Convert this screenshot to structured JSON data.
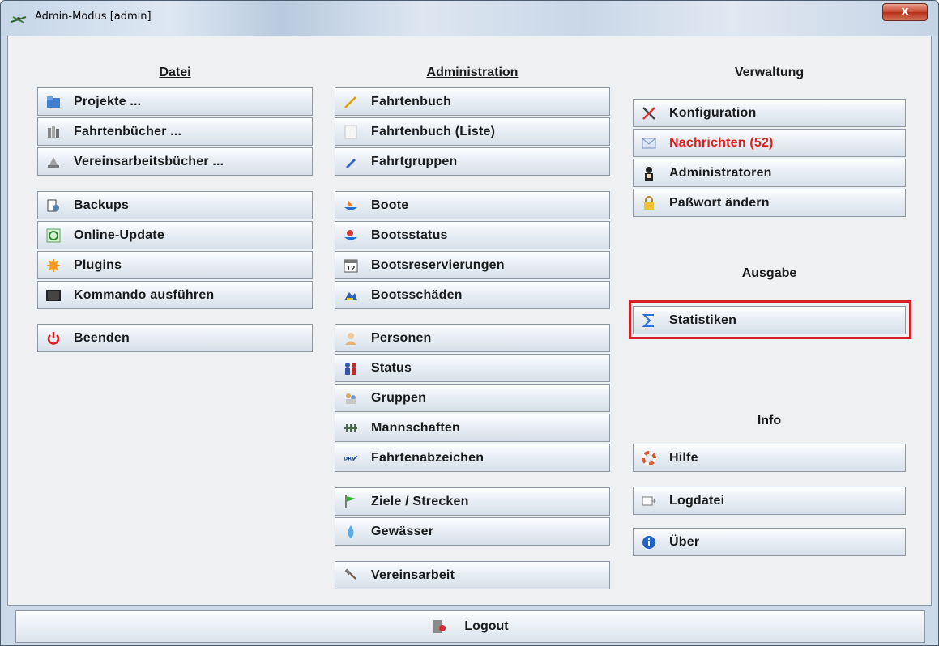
{
  "window": {
    "title": "Admin-Modus [admin]",
    "close_label": "x"
  },
  "datei": {
    "header": "Datei",
    "items": [
      {
        "label": "Projekte ...",
        "icon": "folder-icon"
      },
      {
        "label": "Fahrtenbücher ...",
        "icon": "books-icon"
      },
      {
        "label": "Vereinsarbeitsbücher ...",
        "icon": "work-books-icon"
      },
      {
        "label": "Backups",
        "icon": "backup-icon"
      },
      {
        "label": "Online-Update",
        "icon": "update-icon"
      },
      {
        "label": "Plugins",
        "icon": "plugin-icon"
      },
      {
        "label": "Kommando ausführen",
        "icon": "terminal-icon"
      },
      {
        "label": "Beenden",
        "icon": "power-icon"
      }
    ]
  },
  "administration": {
    "header": "Administration",
    "items": [
      {
        "label": "Fahrtenbuch",
        "icon": "pencil-icon"
      },
      {
        "label": "Fahrtenbuch (Liste)",
        "icon": "list-icon"
      },
      {
        "label": "Fahrtgruppen",
        "icon": "edit-icon"
      },
      {
        "label": "Boote",
        "icon": "boat-icon"
      },
      {
        "label": "Bootsstatus",
        "icon": "boat-status-icon"
      },
      {
        "label": "Bootsreservierungen",
        "icon": "calendar-icon"
      },
      {
        "label": "Bootsschäden",
        "icon": "damage-icon"
      },
      {
        "label": "Personen",
        "icon": "person-icon"
      },
      {
        "label": "Status",
        "icon": "people-icon"
      },
      {
        "label": "Gruppen",
        "icon": "group-icon"
      },
      {
        "label": "Mannschaften",
        "icon": "crew-icon"
      },
      {
        "label": "Fahrtenabzeichen",
        "icon": "drv-badge-icon"
      },
      {
        "label": "Ziele / Strecken",
        "icon": "flag-icon"
      },
      {
        "label": "Gewässer",
        "icon": "water-drop-icon"
      },
      {
        "label": "Vereinsarbeit",
        "icon": "hammer-icon"
      }
    ]
  },
  "verwaltung": {
    "header": "Verwaltung",
    "items": [
      {
        "label": "Konfiguration",
        "icon": "tools-icon"
      },
      {
        "label": "Nachrichten (52)",
        "icon": "mail-icon"
      },
      {
        "label": "Administratoren",
        "icon": "admin-icon"
      },
      {
        "label": "Paßwort ändern",
        "icon": "lock-icon"
      }
    ]
  },
  "ausgabe": {
    "header": "Ausgabe",
    "items": [
      {
        "label": "Statistiken",
        "icon": "sigma-icon"
      }
    ]
  },
  "info": {
    "header": "Info",
    "items": [
      {
        "label": "Hilfe",
        "icon": "lifebuoy-icon"
      },
      {
        "label": "Logdatei",
        "icon": "log-icon"
      },
      {
        "label": "Über",
        "icon": "info-icon"
      }
    ]
  },
  "footer": {
    "logout_label": "Logout",
    "icon": "logout-icon"
  },
  "colors": {
    "highlight_border": "#d62027",
    "message_text": "#e0201c"
  }
}
